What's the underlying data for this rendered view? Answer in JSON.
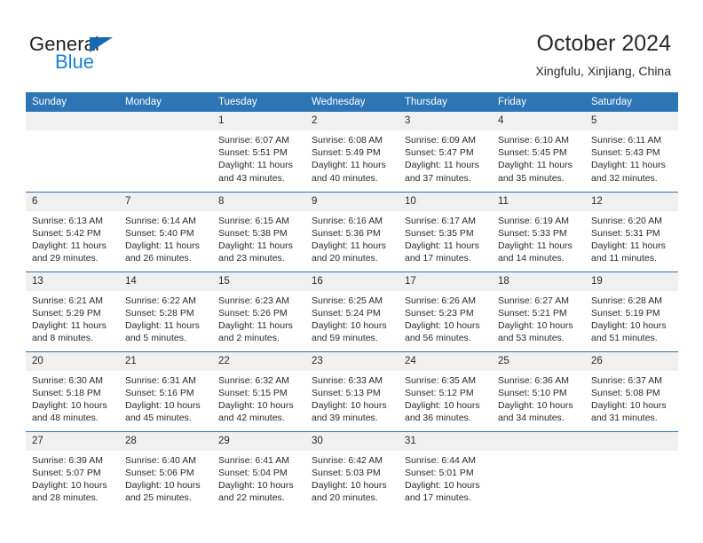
{
  "brand": {
    "name_top": "General",
    "name_bottom": "Blue"
  },
  "header": {
    "title": "October 2024",
    "location": "Xingfulu, Xinjiang, China"
  },
  "weekday_headers": [
    "Sunday",
    "Monday",
    "Tuesday",
    "Wednesday",
    "Thursday",
    "Friday",
    "Saturday"
  ],
  "colors": {
    "header_blue": "#2e75b6",
    "daynum_gray": "#f0f0f0",
    "logo_blue": "#1b7fd4",
    "text": "#2a2a2a"
  },
  "weeks": [
    [
      {
        "day": "",
        "lines": []
      },
      {
        "day": "",
        "lines": []
      },
      {
        "day": "1",
        "lines": [
          "Sunrise: 6:07 AM",
          "Sunset: 5:51 PM",
          "Daylight: 11 hours",
          "and 43 minutes."
        ]
      },
      {
        "day": "2",
        "lines": [
          "Sunrise: 6:08 AM",
          "Sunset: 5:49 PM",
          "Daylight: 11 hours",
          "and 40 minutes."
        ]
      },
      {
        "day": "3",
        "lines": [
          "Sunrise: 6:09 AM",
          "Sunset: 5:47 PM",
          "Daylight: 11 hours",
          "and 37 minutes."
        ]
      },
      {
        "day": "4",
        "lines": [
          "Sunrise: 6:10 AM",
          "Sunset: 5:45 PM",
          "Daylight: 11 hours",
          "and 35 minutes."
        ]
      },
      {
        "day": "5",
        "lines": [
          "Sunrise: 6:11 AM",
          "Sunset: 5:43 PM",
          "Daylight: 11 hours",
          "and 32 minutes."
        ]
      }
    ],
    [
      {
        "day": "6",
        "lines": [
          "Sunrise: 6:13 AM",
          "Sunset: 5:42 PM",
          "Daylight: 11 hours",
          "and 29 minutes."
        ]
      },
      {
        "day": "7",
        "lines": [
          "Sunrise: 6:14 AM",
          "Sunset: 5:40 PM",
          "Daylight: 11 hours",
          "and 26 minutes."
        ]
      },
      {
        "day": "8",
        "lines": [
          "Sunrise: 6:15 AM",
          "Sunset: 5:38 PM",
          "Daylight: 11 hours",
          "and 23 minutes."
        ]
      },
      {
        "day": "9",
        "lines": [
          "Sunrise: 6:16 AM",
          "Sunset: 5:36 PM",
          "Daylight: 11 hours",
          "and 20 minutes."
        ]
      },
      {
        "day": "10",
        "lines": [
          "Sunrise: 6:17 AM",
          "Sunset: 5:35 PM",
          "Daylight: 11 hours",
          "and 17 minutes."
        ]
      },
      {
        "day": "11",
        "lines": [
          "Sunrise: 6:19 AM",
          "Sunset: 5:33 PM",
          "Daylight: 11 hours",
          "and 14 minutes."
        ]
      },
      {
        "day": "12",
        "lines": [
          "Sunrise: 6:20 AM",
          "Sunset: 5:31 PM",
          "Daylight: 11 hours",
          "and 11 minutes."
        ]
      }
    ],
    [
      {
        "day": "13",
        "lines": [
          "Sunrise: 6:21 AM",
          "Sunset: 5:29 PM",
          "Daylight: 11 hours",
          "and 8 minutes."
        ]
      },
      {
        "day": "14",
        "lines": [
          "Sunrise: 6:22 AM",
          "Sunset: 5:28 PM",
          "Daylight: 11 hours",
          "and 5 minutes."
        ]
      },
      {
        "day": "15",
        "lines": [
          "Sunrise: 6:23 AM",
          "Sunset: 5:26 PM",
          "Daylight: 11 hours",
          "and 2 minutes."
        ]
      },
      {
        "day": "16",
        "lines": [
          "Sunrise: 6:25 AM",
          "Sunset: 5:24 PM",
          "Daylight: 10 hours",
          "and 59 minutes."
        ]
      },
      {
        "day": "17",
        "lines": [
          "Sunrise: 6:26 AM",
          "Sunset: 5:23 PM",
          "Daylight: 10 hours",
          "and 56 minutes."
        ]
      },
      {
        "day": "18",
        "lines": [
          "Sunrise: 6:27 AM",
          "Sunset: 5:21 PM",
          "Daylight: 10 hours",
          "and 53 minutes."
        ]
      },
      {
        "day": "19",
        "lines": [
          "Sunrise: 6:28 AM",
          "Sunset: 5:19 PM",
          "Daylight: 10 hours",
          "and 51 minutes."
        ]
      }
    ],
    [
      {
        "day": "20",
        "lines": [
          "Sunrise: 6:30 AM",
          "Sunset: 5:18 PM",
          "Daylight: 10 hours",
          "and 48 minutes."
        ]
      },
      {
        "day": "21",
        "lines": [
          "Sunrise: 6:31 AM",
          "Sunset: 5:16 PM",
          "Daylight: 10 hours",
          "and 45 minutes."
        ]
      },
      {
        "day": "22",
        "lines": [
          "Sunrise: 6:32 AM",
          "Sunset: 5:15 PM",
          "Daylight: 10 hours",
          "and 42 minutes."
        ]
      },
      {
        "day": "23",
        "lines": [
          "Sunrise: 6:33 AM",
          "Sunset: 5:13 PM",
          "Daylight: 10 hours",
          "and 39 minutes."
        ]
      },
      {
        "day": "24",
        "lines": [
          "Sunrise: 6:35 AM",
          "Sunset: 5:12 PM",
          "Daylight: 10 hours",
          "and 36 minutes."
        ]
      },
      {
        "day": "25",
        "lines": [
          "Sunrise: 6:36 AM",
          "Sunset: 5:10 PM",
          "Daylight: 10 hours",
          "and 34 minutes."
        ]
      },
      {
        "day": "26",
        "lines": [
          "Sunrise: 6:37 AM",
          "Sunset: 5:08 PM",
          "Daylight: 10 hours",
          "and 31 minutes."
        ]
      }
    ],
    [
      {
        "day": "27",
        "lines": [
          "Sunrise: 6:39 AM",
          "Sunset: 5:07 PM",
          "Daylight: 10 hours",
          "and 28 minutes."
        ]
      },
      {
        "day": "28",
        "lines": [
          "Sunrise: 6:40 AM",
          "Sunset: 5:06 PM",
          "Daylight: 10 hours",
          "and 25 minutes."
        ]
      },
      {
        "day": "29",
        "lines": [
          "Sunrise: 6:41 AM",
          "Sunset: 5:04 PM",
          "Daylight: 10 hours",
          "and 22 minutes."
        ]
      },
      {
        "day": "30",
        "lines": [
          "Sunrise: 6:42 AM",
          "Sunset: 5:03 PM",
          "Daylight: 10 hours",
          "and 20 minutes."
        ]
      },
      {
        "day": "31",
        "lines": [
          "Sunrise: 6:44 AM",
          "Sunset: 5:01 PM",
          "Daylight: 10 hours",
          "and 17 minutes."
        ]
      },
      {
        "day": "",
        "lines": []
      },
      {
        "day": "",
        "lines": []
      }
    ]
  ]
}
